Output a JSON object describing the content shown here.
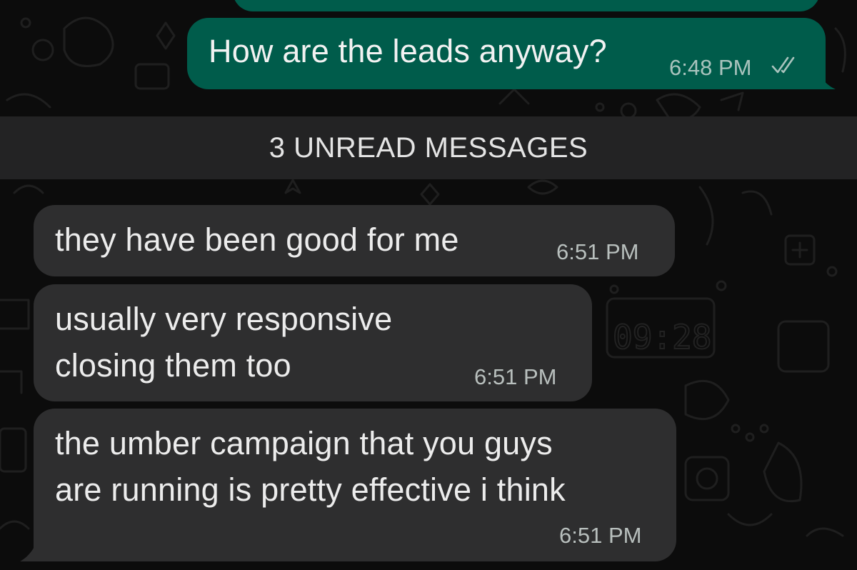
{
  "wallpaper": {
    "clock_text": "09:28"
  },
  "messages": [
    {
      "direction": "outgoing",
      "text": "How are the leads anyway?",
      "time": "6:48 PM",
      "status_icon": "double-check-icon"
    },
    {
      "direction": "incoming",
      "text": "they have been good for me",
      "time": "6:51 PM"
    },
    {
      "direction": "incoming",
      "lines": [
        "usually very responsive",
        "closing them too"
      ],
      "time": "6:51 PM"
    },
    {
      "direction": "incoming",
      "lines": [
        "the umber campaign that you guys",
        "are running is pretty effective i think"
      ],
      "time": "6:51 PM"
    }
  ],
  "unread_banner": "3 UNREAD MESSAGES",
  "colors": {
    "background": "#0c0c0c",
    "outgoing_bubble": "#005c4b",
    "incoming_bubble": "#2e2e2f",
    "unread_bar": "#232324"
  }
}
